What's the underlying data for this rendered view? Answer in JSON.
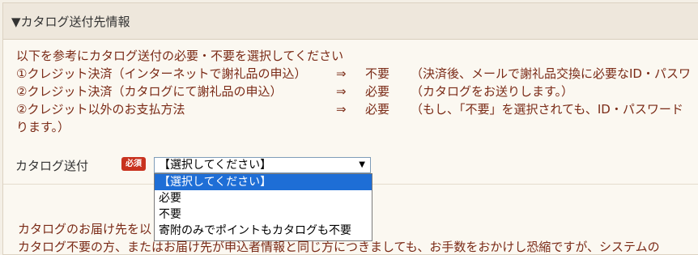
{
  "section": {
    "title": "▼カタログ送付先情報"
  },
  "notes": {
    "intro": "以下を参考にカタログ送付の必要・不要を選択してください",
    "rows": [
      {
        "label": "①クレジット決済（インターネットで謝礼品の申込）",
        "arrow": "⇒",
        "value": "不要",
        "note": "（決済後、メールで謝礼品交換に必要なID・パスワ"
      },
      {
        "label": "②クレジット決済（カタログにて謝礼品の申込）",
        "arrow": "⇒",
        "value": "必要",
        "note": "（カタログをお送りします。）"
      },
      {
        "label": "②クレジット以外のお支払方法",
        "arrow": "⇒",
        "value": "必要",
        "note": "（もし、「不要」を選択されても、ID・パスワード"
      }
    ],
    "continuation": "ります。）"
  },
  "field": {
    "label": "カタログ送付",
    "required_badge": "必須",
    "selected": "【選択してください】",
    "options": [
      "【選択してください】",
      "必要",
      "不要",
      "寄附のみでポイントもカタログも不要"
    ]
  },
  "delivery": {
    "line1": "カタログのお届け先を以",
    "line2": "カタログ不要の方、またはお届け先が申込者情報と同じ方につきましても、お手数をおかけし恐縮ですが、システムの"
  }
}
